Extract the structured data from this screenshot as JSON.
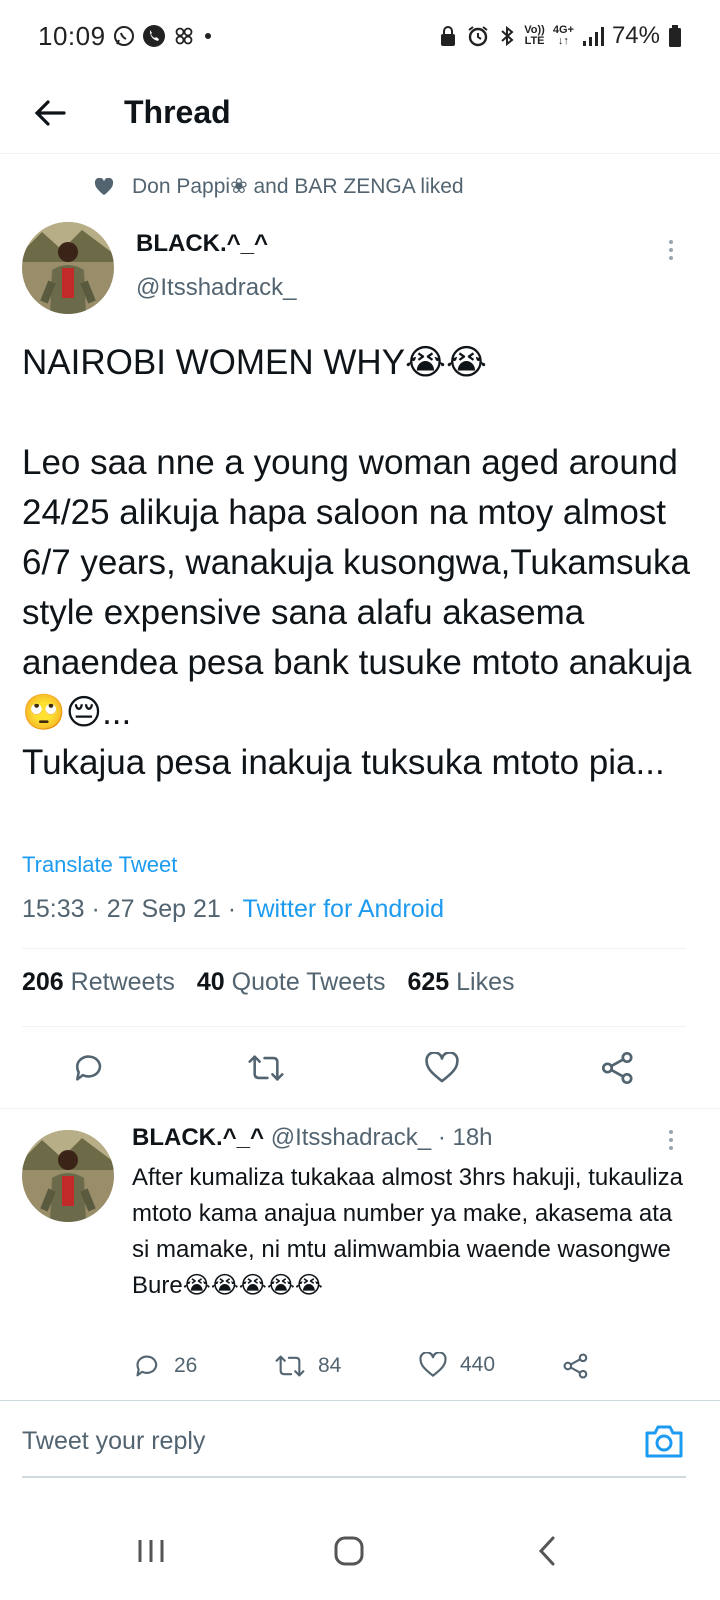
{
  "status_bar": {
    "time": "10:09",
    "battery": "74%",
    "network": "4G+",
    "volte": "Vo))",
    "lte": "LTE"
  },
  "header": {
    "title": "Thread"
  },
  "social_context": {
    "text": "Don Pappi❀ and BAR ZENGA liked"
  },
  "tweet": {
    "display_name": "BLACK.^_^",
    "handle": "@Itsshadrack_",
    "text": "NAIROBI WOMEN WHY😭😭\n\nLeo saa nne a young woman aged around 24/25 alikuja hapa saloon na mtoy almost 6/7 years, wanakuja kusongwa,Tukamsuka style expensive sana alafu akasema  anaendea pesa bank tusuke mtoto anakuja🙄😔...\nTukajua pesa inakuja tuksuka mtoto pia...",
    "translate": "Translate Tweet",
    "time": "15:33 · 27 Sep 21 · ",
    "source": "Twitter for Android",
    "retweets": "206",
    "retweets_label": "Retweets",
    "quotes": "40",
    "quotes_label": "Quote Tweets",
    "likes": "625",
    "likes_label": "Likes"
  },
  "reply": {
    "display_name": "BLACK.^_^",
    "handle": "@Itsshadrack_",
    "time": " · 18h",
    "text": "After kumaliza tukakaa almost 3hrs hakuji, tukauliza mtoto kama anajua number ya make, akasema ata si mamake, ni mtu alimwambia waende wasongwe Bure😭😭😭😭😭",
    "replies": "26",
    "retweets": "84",
    "likes": "440"
  },
  "composer": {
    "placeholder": "Tweet your reply"
  },
  "colors": {
    "accent": "#1d9bf0",
    "secondary_text": "#536471",
    "text": "#0f1419"
  }
}
